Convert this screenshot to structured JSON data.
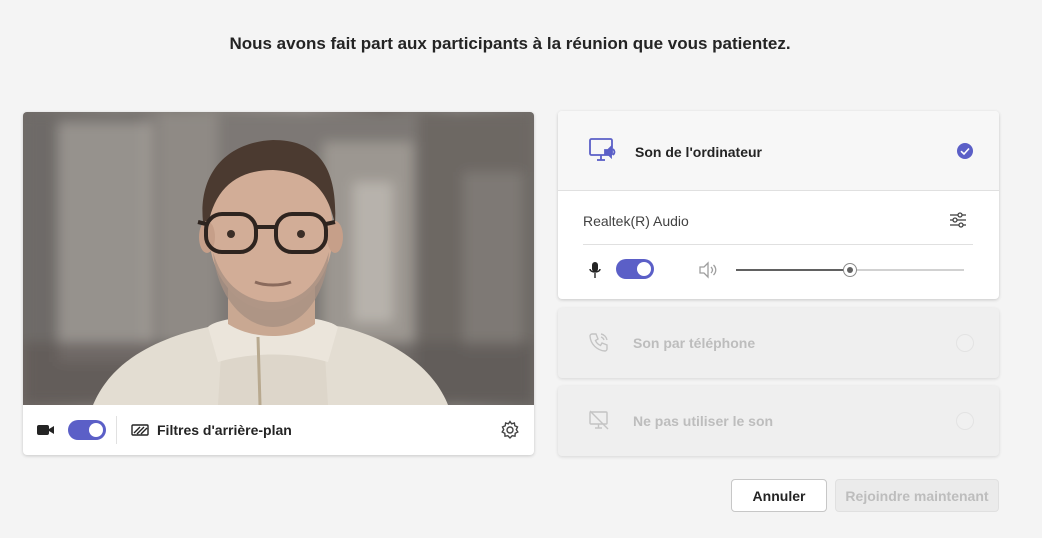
{
  "header": {
    "title": "Nous avons fait part aux participants à la réunion que vous patientez."
  },
  "video": {
    "camera_icon": "video-camera-icon",
    "camera_on": true,
    "background_filters_label": "Filtres d'arrière-plan",
    "background_filters_icon": "background-effects-icon",
    "settings_icon": "gear-icon"
  },
  "audio": {
    "computer_audio": {
      "label": "Son de l'ordinateur",
      "icon": "computer-speaker-icon",
      "selected": true,
      "device_name": "Realtek(R) Audio",
      "device_settings_icon": "sliders-icon",
      "mic_icon": "microphone-icon",
      "mic_on": true,
      "speaker_icon": "speaker-icon",
      "speaker_volume": 0.5
    },
    "phone_audio": {
      "label": "Son par téléphone",
      "icon": "phone-icon",
      "selected": false
    },
    "no_audio": {
      "label": "Ne pas utiliser le son",
      "icon": "no-audio-icon",
      "selected": false
    }
  },
  "footer": {
    "cancel_label": "Annuler",
    "join_label": "Rejoindre maintenant"
  },
  "colors": {
    "accent": "#5b5fc7",
    "background": "#f4f4f4",
    "disabled_text": "#bdbdbd"
  }
}
